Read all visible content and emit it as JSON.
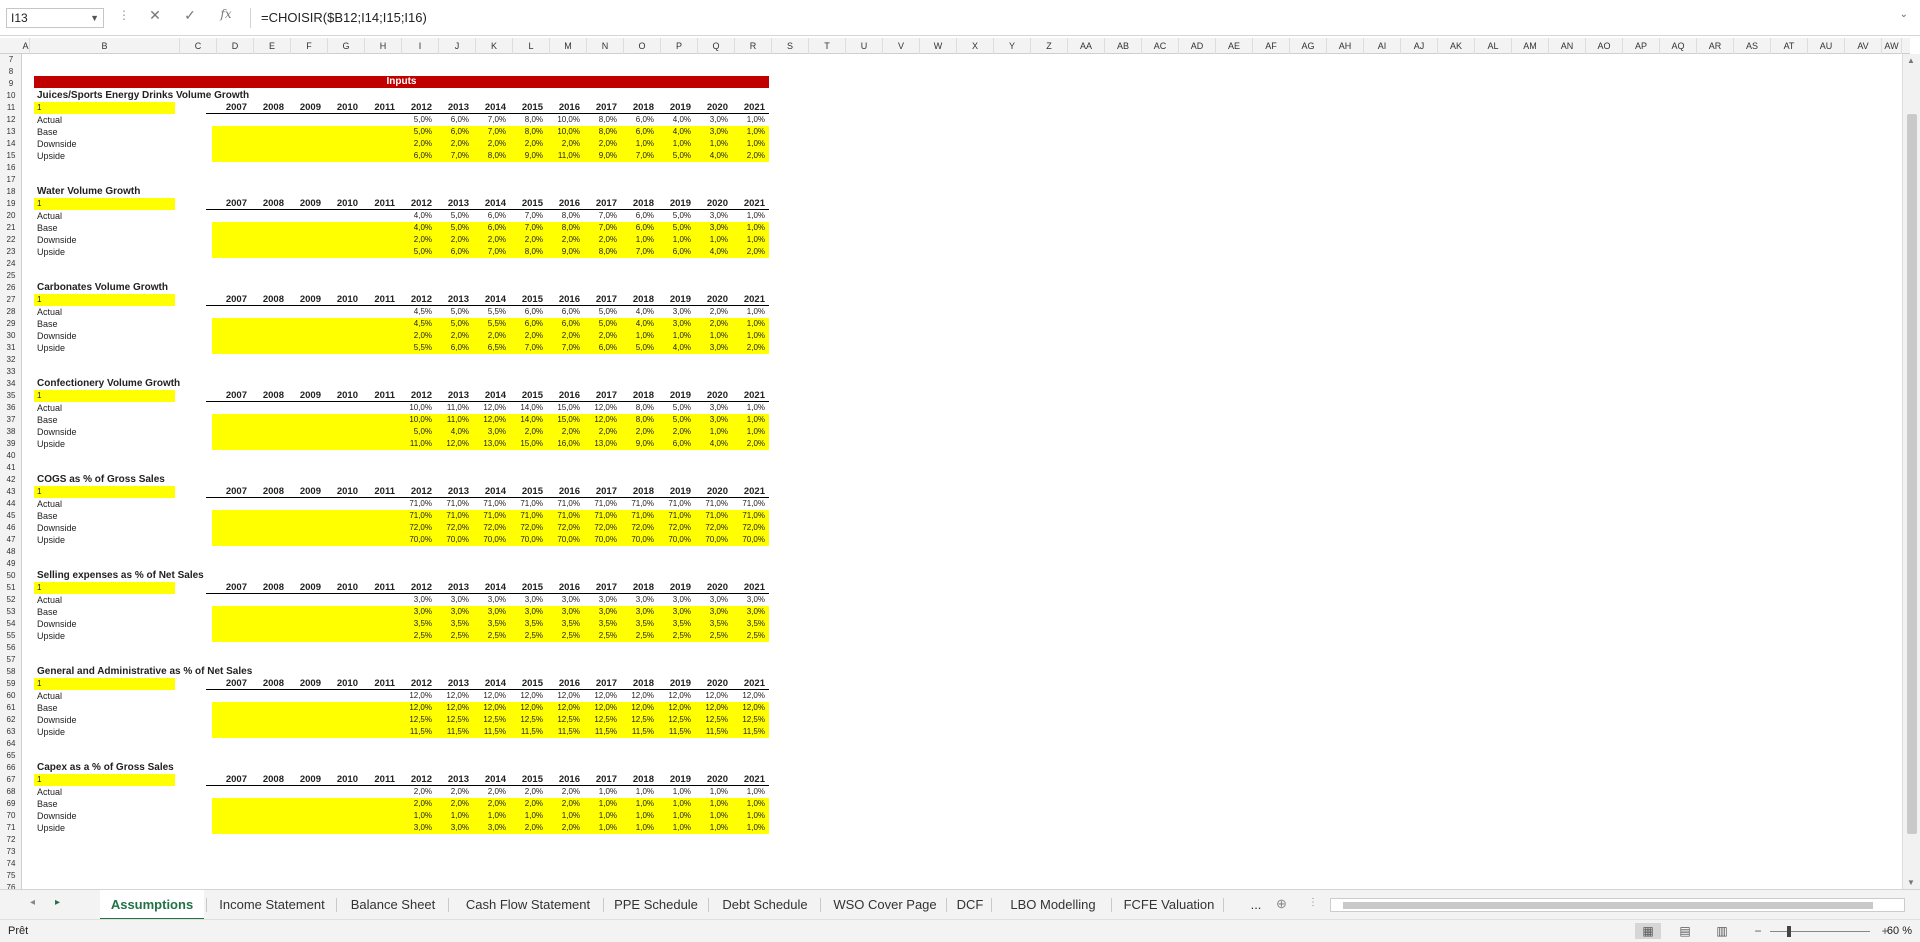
{
  "formula_bar": {
    "name_box": "I13",
    "formula": "=CHOISIR($B12;I14;I15;I16)"
  },
  "columns": [
    "A",
    "B",
    "C",
    "D",
    "E",
    "F",
    "G",
    "H",
    "I",
    "J",
    "K",
    "L",
    "M",
    "N",
    "O",
    "P",
    "Q",
    "R",
    "S",
    "T",
    "U",
    "V",
    "W",
    "X",
    "Y",
    "Z",
    "AA",
    "AB",
    "AC",
    "AD",
    "AE",
    "AF",
    "AG",
    "AH",
    "AI",
    "AJ",
    "AK",
    "AL",
    "AM",
    "AN",
    "AO",
    "AP",
    "AQ",
    "AR",
    "AS",
    "AT",
    "AU",
    "AV",
    "AW"
  ],
  "rows": [
    "7",
    "8",
    "9",
    "10",
    "11",
    "12",
    "13",
    "14",
    "15",
    "16",
    "17",
    "18",
    "19",
    "20",
    "21",
    "22",
    "23",
    "24",
    "25",
    "26",
    "27",
    "28",
    "29",
    "30",
    "31",
    "32",
    "33",
    "34",
    "35",
    "36",
    "37",
    "38",
    "39",
    "40",
    "41",
    "42",
    "43",
    "44",
    "45",
    "46",
    "47",
    "48",
    "49",
    "50",
    "51",
    "52",
    "53",
    "54",
    "55",
    "56",
    "57",
    "58",
    "59",
    "60",
    "61",
    "62",
    "63",
    "64",
    "65",
    "66",
    "67",
    "68",
    "69",
    "70",
    "71",
    "72",
    "73",
    "74",
    "75",
    "76"
  ],
  "banner": "Inputs",
  "years": [
    "2007",
    "2008",
    "2009",
    "2010",
    "2011",
    "2012",
    "2013",
    "2014",
    "2015",
    "2016",
    "2017",
    "2018",
    "2019",
    "2020",
    "2021"
  ],
  "sections": [
    {
      "title": "Juices/Sports Energy Drinks Volume Growth",
      "selector": "1",
      "rows": [
        {
          "label": "Actual",
          "values": [
            "5,0%",
            "6,0%",
            "7,0%",
            "8,0%",
            "10,0%",
            "8,0%",
            "6,0%",
            "4,0%",
            "3,0%",
            "1,0%"
          ]
        },
        {
          "label": "Base",
          "values": [
            "5,0%",
            "6,0%",
            "7,0%",
            "8,0%",
            "10,0%",
            "8,0%",
            "6,0%",
            "4,0%",
            "3,0%",
            "1,0%"
          ]
        },
        {
          "label": "Downside",
          "values": [
            "2,0%",
            "2,0%",
            "2,0%",
            "2,0%",
            "2,0%",
            "2,0%",
            "1,0%",
            "1,0%",
            "1,0%",
            "1,0%"
          ]
        },
        {
          "label": "Upside",
          "values": [
            "6,0%",
            "7,0%",
            "8,0%",
            "9,0%",
            "11,0%",
            "9,0%",
            "7,0%",
            "5,0%",
            "4,0%",
            "2,0%"
          ]
        }
      ]
    },
    {
      "title": "Water Volume Growth",
      "selector": "1",
      "rows": [
        {
          "label": "Actual",
          "values": [
            "4,0%",
            "5,0%",
            "6,0%",
            "7,0%",
            "8,0%",
            "7,0%",
            "6,0%",
            "5,0%",
            "3,0%",
            "1,0%"
          ]
        },
        {
          "label": "Base",
          "values": [
            "4,0%",
            "5,0%",
            "6,0%",
            "7,0%",
            "8,0%",
            "7,0%",
            "6,0%",
            "5,0%",
            "3,0%",
            "1,0%"
          ]
        },
        {
          "label": "Downside",
          "values": [
            "2,0%",
            "2,0%",
            "2,0%",
            "2,0%",
            "2,0%",
            "2,0%",
            "1,0%",
            "1,0%",
            "1,0%",
            "1,0%"
          ]
        },
        {
          "label": "Upside",
          "values": [
            "5,0%",
            "6,0%",
            "7,0%",
            "8,0%",
            "9,0%",
            "8,0%",
            "7,0%",
            "6,0%",
            "4,0%",
            "2,0%"
          ]
        }
      ]
    },
    {
      "title": "Carbonates Volume Growth",
      "selector": "1",
      "rows": [
        {
          "label": "Actual",
          "values": [
            "4,5%",
            "5,0%",
            "5,5%",
            "6,0%",
            "6,0%",
            "5,0%",
            "4,0%",
            "3,0%",
            "2,0%",
            "1,0%"
          ]
        },
        {
          "label": "Base",
          "values": [
            "4,5%",
            "5,0%",
            "5,5%",
            "6,0%",
            "6,0%",
            "5,0%",
            "4,0%",
            "3,0%",
            "2,0%",
            "1,0%"
          ]
        },
        {
          "label": "Downside",
          "values": [
            "2,0%",
            "2,0%",
            "2,0%",
            "2,0%",
            "2,0%",
            "2,0%",
            "1,0%",
            "1,0%",
            "1,0%",
            "1,0%"
          ]
        },
        {
          "label": "Upside",
          "values": [
            "5,5%",
            "6,0%",
            "6,5%",
            "7,0%",
            "7,0%",
            "6,0%",
            "5,0%",
            "4,0%",
            "3,0%",
            "2,0%"
          ]
        }
      ]
    },
    {
      "title": "Confectionery Volume Growth",
      "selector": "1",
      "rows": [
        {
          "label": "Actual",
          "values": [
            "10,0%",
            "11,0%",
            "12,0%",
            "14,0%",
            "15,0%",
            "12,0%",
            "8,0%",
            "5,0%",
            "3,0%",
            "1,0%"
          ]
        },
        {
          "label": "Base",
          "values": [
            "10,0%",
            "11,0%",
            "12,0%",
            "14,0%",
            "15,0%",
            "12,0%",
            "8,0%",
            "5,0%",
            "3,0%",
            "1,0%"
          ]
        },
        {
          "label": "Downside",
          "values": [
            "5,0%",
            "4,0%",
            "3,0%",
            "2,0%",
            "2,0%",
            "2,0%",
            "2,0%",
            "2,0%",
            "1,0%",
            "1,0%"
          ]
        },
        {
          "label": "Upside",
          "values": [
            "11,0%",
            "12,0%",
            "13,0%",
            "15,0%",
            "16,0%",
            "13,0%",
            "9,0%",
            "6,0%",
            "4,0%",
            "2,0%"
          ]
        }
      ]
    },
    {
      "title": "COGS as % of Gross Sales",
      "selector": "1",
      "rows": [
        {
          "label": "Actual",
          "values": [
            "71,0%",
            "71,0%",
            "71,0%",
            "71,0%",
            "71,0%",
            "71,0%",
            "71,0%",
            "71,0%",
            "71,0%",
            "71,0%"
          ]
        },
        {
          "label": "Base",
          "values": [
            "71,0%",
            "71,0%",
            "71,0%",
            "71,0%",
            "71,0%",
            "71,0%",
            "71,0%",
            "71,0%",
            "71,0%",
            "71,0%"
          ]
        },
        {
          "label": "Downside",
          "values": [
            "72,0%",
            "72,0%",
            "72,0%",
            "72,0%",
            "72,0%",
            "72,0%",
            "72,0%",
            "72,0%",
            "72,0%",
            "72,0%"
          ]
        },
        {
          "label": "Upside",
          "values": [
            "70,0%",
            "70,0%",
            "70,0%",
            "70,0%",
            "70,0%",
            "70,0%",
            "70,0%",
            "70,0%",
            "70,0%",
            "70,0%"
          ]
        }
      ]
    },
    {
      "title": "Selling expenses as % of Net Sales",
      "selector": "1",
      "rows": [
        {
          "label": "Actual",
          "values": [
            "3,0%",
            "3,0%",
            "3,0%",
            "3,0%",
            "3,0%",
            "3,0%",
            "3,0%",
            "3,0%",
            "3,0%",
            "3,0%"
          ]
        },
        {
          "label": "Base",
          "values": [
            "3,0%",
            "3,0%",
            "3,0%",
            "3,0%",
            "3,0%",
            "3,0%",
            "3,0%",
            "3,0%",
            "3,0%",
            "3,0%"
          ]
        },
        {
          "label": "Downside",
          "values": [
            "3,5%",
            "3,5%",
            "3,5%",
            "3,5%",
            "3,5%",
            "3,5%",
            "3,5%",
            "3,5%",
            "3,5%",
            "3,5%"
          ]
        },
        {
          "label": "Upside",
          "values": [
            "2,5%",
            "2,5%",
            "2,5%",
            "2,5%",
            "2,5%",
            "2,5%",
            "2,5%",
            "2,5%",
            "2,5%",
            "2,5%"
          ]
        }
      ]
    },
    {
      "title": "General and Administrative as % of Net Sales",
      "selector": "1",
      "rows": [
        {
          "label": "Actual",
          "values": [
            "12,0%",
            "12,0%",
            "12,0%",
            "12,0%",
            "12,0%",
            "12,0%",
            "12,0%",
            "12,0%",
            "12,0%",
            "12,0%"
          ]
        },
        {
          "label": "Base",
          "values": [
            "12,0%",
            "12,0%",
            "12,0%",
            "12,0%",
            "12,0%",
            "12,0%",
            "12,0%",
            "12,0%",
            "12,0%",
            "12,0%"
          ]
        },
        {
          "label": "Downside",
          "values": [
            "12,5%",
            "12,5%",
            "12,5%",
            "12,5%",
            "12,5%",
            "12,5%",
            "12,5%",
            "12,5%",
            "12,5%",
            "12,5%"
          ]
        },
        {
          "label": "Upside",
          "values": [
            "11,5%",
            "11,5%",
            "11,5%",
            "11,5%",
            "11,5%",
            "11,5%",
            "11,5%",
            "11,5%",
            "11,5%",
            "11,5%"
          ]
        }
      ]
    },
    {
      "title": "Capex as a % of Gross Sales",
      "selector": "1",
      "rows": [
        {
          "label": "Actual",
          "values": [
            "2,0%",
            "2,0%",
            "2,0%",
            "2,0%",
            "2,0%",
            "1,0%",
            "1,0%",
            "1,0%",
            "1,0%",
            "1,0%"
          ]
        },
        {
          "label": "Base",
          "values": [
            "2,0%",
            "2,0%",
            "2,0%",
            "2,0%",
            "2,0%",
            "1,0%",
            "1,0%",
            "1,0%",
            "1,0%",
            "1,0%"
          ]
        },
        {
          "label": "Downside",
          "values": [
            "1,0%",
            "1,0%",
            "1,0%",
            "1,0%",
            "1,0%",
            "1,0%",
            "1,0%",
            "1,0%",
            "1,0%",
            "1,0%"
          ]
        },
        {
          "label": "Upside",
          "values": [
            "3,0%",
            "3,0%",
            "3,0%",
            "2,0%",
            "2,0%",
            "1,0%",
            "1,0%",
            "1,0%",
            "1,0%",
            "1,0%"
          ]
        }
      ]
    }
  ],
  "sheet_tabs": [
    "Assumptions",
    "Income Statement",
    "Balance Sheet",
    "Cash Flow Statement",
    "PPE Schedule",
    "Debt Schedule",
    "WSO Cover Page",
    "DCF",
    "LBO Modelling",
    "FCFE Valuation",
    "..."
  ],
  "active_tab": "Assumptions",
  "status": {
    "ready": "Prêt",
    "zoom": "60 %"
  },
  "colors": {
    "accent": "#217346",
    "banner": "#c00000",
    "highlight": "#ffff00"
  }
}
